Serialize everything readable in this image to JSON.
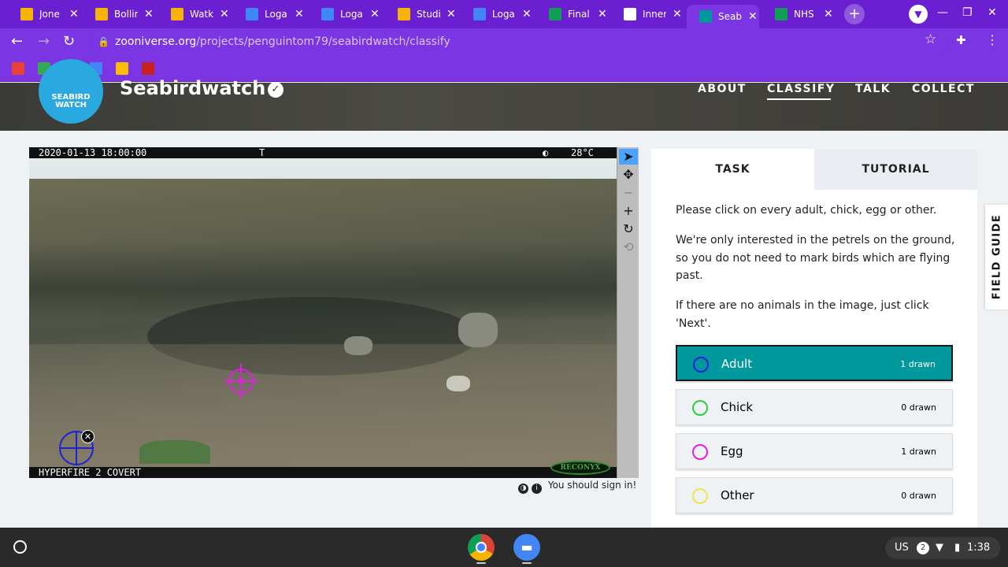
{
  "browser": {
    "tabs": [
      {
        "label": "Jone",
        "color": "#f4b400"
      },
      {
        "label": "Bollin",
        "color": "#f4b400"
      },
      {
        "label": "Watk",
        "color": "#f4b400"
      },
      {
        "label": "Loga",
        "color": "#4285f4"
      },
      {
        "label": "Loga",
        "color": "#4285f4"
      },
      {
        "label": "Studi",
        "color": "#f4b400"
      },
      {
        "label": "Loga",
        "color": "#4285f4"
      },
      {
        "label": "Final",
        "color": "#0f9d58"
      },
      {
        "label": "Inner",
        "color": "#ffffff"
      },
      {
        "label": "Seab",
        "color": "#00979d"
      },
      {
        "label": "NHS",
        "color": "#0f9d58"
      }
    ],
    "tab_close": "✕",
    "new_tab": "+",
    "url_host": "zooniverse.org",
    "url_path": "/projects/penguintom79/seabirdwatch/classify",
    "bookmark_colors": [
      "#e94235",
      "#34a853",
      "#ea4335",
      "#4285f4",
      "#fbbc04",
      "#c5221f"
    ]
  },
  "site": {
    "project_title": "Seabirdwatch",
    "logo_text_1": "SEABIRD",
    "logo_text_2": "WATCH",
    "nav": [
      "ABOUT",
      "CLASSIFY",
      "TALK",
      "COLLECT"
    ]
  },
  "viewer": {
    "cam_timestamp": "2020-01-13 18:00:00",
    "cam_marker": "T",
    "cam_temp": "28°C",
    "cam_model": "HYPERFIRE 2 COVERT",
    "cam_brand": "RECONYX",
    "sign_in_note": "You should sign in!"
  },
  "task": {
    "tab_task": "TASK",
    "tab_tutorial": "TUTORIAL",
    "instruction_1": "Please click on every adult, chick, egg or other.",
    "instruction_2": "We're only interested in the petrels on the ground, so you do not need to mark birds which are flying past.",
    "instruction_3": "If there are no animals in the image, just click 'Next'.",
    "choices": [
      {
        "label": "Adult",
        "count": "1 drawn",
        "color": "#1a23d6"
      },
      {
        "label": "Chick",
        "count": "0 drawn",
        "color": "#2ecc40"
      },
      {
        "label": "Egg",
        "count": "1 drawn",
        "color": "#e020e0"
      },
      {
        "label": "Other",
        "count": "0 drawn",
        "color": "#e8e84a"
      }
    ],
    "field_guide": "FIELD GUIDE"
  },
  "shelf": {
    "locale": "US",
    "notifications": "2",
    "time": "1:38"
  }
}
